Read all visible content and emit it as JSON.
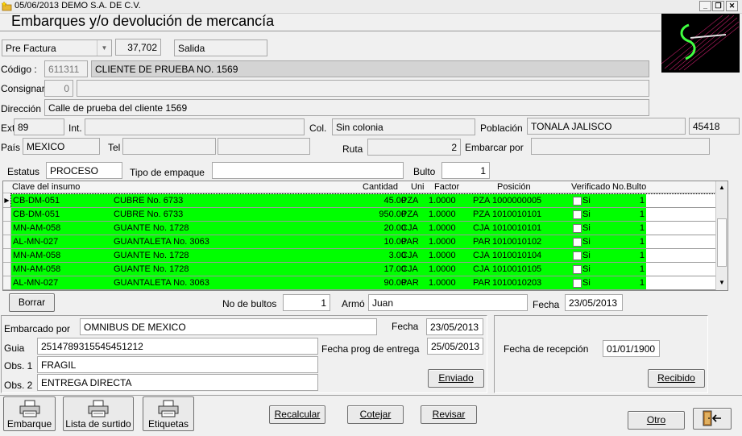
{
  "window": {
    "title": "05/06/2013  DEMO  S.A. DE C.V.",
    "heading": "Embarques y/o devolución de mercancía",
    "controls": [
      "_",
      "❐",
      "✕"
    ]
  },
  "doc": {
    "type_selected": "Pre Factura",
    "number": "37,702",
    "movement": "Salida"
  },
  "client": {
    "codigo_label": "Código :",
    "codigo": "611311",
    "name": "CLIENTE DE PRUEBA NO. 1569",
    "consignar_label": "Consignar",
    "consignar": "0",
    "consignar_name": "",
    "direccion_label": "Dirección :",
    "direccion": "Calle de prueba del cliente 1569",
    "ext_label": "Ext.",
    "ext": "89",
    "int_label": "Int.",
    "int": "",
    "col_label": "Col.",
    "col": "Sin colonia",
    "poblacion_label": "Población",
    "poblacion": "TONALA  JALISCO",
    "cp": "45418",
    "pais_label": "País :",
    "pais": "MEXICO",
    "tel_label": "Tel",
    "tel": "",
    "tel2": "",
    "ruta_label": "Ruta",
    "ruta": "2",
    "embarcar_label": "Embarcar por",
    "embarcar": ""
  },
  "status": {
    "estatus_label": "Estatus",
    "estatus": "PROCESO",
    "tipo_empaque_label": "Tipo de empaque",
    "tipo_empaque": "",
    "bulto_label": "Bulto",
    "bulto": "1"
  },
  "grid": {
    "headers": {
      "clave": "Clave del insumo",
      "cantidad": "Cantidad",
      "uni": "Uni",
      "factor": "Factor",
      "posicion": "Posición",
      "verificado": "Verificado",
      "nobulto": "No.Bulto"
    },
    "rows": [
      {
        "clave": "CB-DM-051",
        "desc": "CUBRE No. 6733",
        "cantidad": "45.00",
        "uni": "PZA",
        "factor": "1.0000",
        "uni2": "PZA",
        "posicion": "1000000005",
        "verificado": "Si",
        "bulto": "1"
      },
      {
        "clave": "CB-DM-051",
        "desc": "CUBRE No. 6733",
        "cantidad": "950.00",
        "uni": "PZA",
        "factor": "1.0000",
        "uni2": "PZA",
        "posicion": "1010010101",
        "verificado": "Si",
        "bulto": "1"
      },
      {
        "clave": "MN-AM-058",
        "desc": "GUANTE No. 1728",
        "cantidad": "20.00",
        "uni": "CJA",
        "factor": "1.0000",
        "uni2": "CJA",
        "posicion": "1010010101",
        "verificado": "Si",
        "bulto": "1"
      },
      {
        "clave": "AL-MN-027",
        "desc": "GUANTALETA No. 3063",
        "cantidad": "10.00",
        "uni": "PAR",
        "factor": "1.0000",
        "uni2": "PAR",
        "posicion": "1010010102",
        "verificado": "Si",
        "bulto": "1"
      },
      {
        "clave": "MN-AM-058",
        "desc": "GUANTE No. 1728",
        "cantidad": "3.00",
        "uni": "CJA",
        "factor": "1.0000",
        "uni2": "CJA",
        "posicion": "1010010104",
        "verificado": "Si",
        "bulto": "1"
      },
      {
        "clave": "MN-AM-058",
        "desc": "GUANTE No. 1728",
        "cantidad": "17.00",
        "uni": "CJA",
        "factor": "1.0000",
        "uni2": "CJA",
        "posicion": "1010010105",
        "verificado": "Si",
        "bulto": "1"
      },
      {
        "clave": "AL-MN-027",
        "desc": "GUANTALETA No. 3063",
        "cantidad": "90.00",
        "uni": "PAR",
        "factor": "1.0000",
        "uni2": "PAR",
        "posicion": "1010010203",
        "verificado": "Si",
        "bulto": "1"
      }
    ],
    "row_color": "#00ff00"
  },
  "middle": {
    "borrar": "Borrar",
    "no_bultos_label": "No de bultos",
    "no_bultos": "1",
    "armo_label": "Armó",
    "armo": "Juan",
    "fecha_label": "Fecha",
    "fecha": "23/05/2013"
  },
  "shipping": {
    "embarcado_label": "Embarcado por",
    "embarcado": "OMNIBUS DE MEXICO",
    "fecha_label": "Fecha",
    "fecha": "23/05/2013",
    "guia_label": "Guia",
    "guia": "2514789315545451212",
    "fecha_prog_label": "Fecha prog de entrega",
    "fecha_prog": "25/05/2013",
    "obs1_label": "Obs. 1",
    "obs1": "FRAGIL",
    "obs2_label": "Obs. 2",
    "obs2": "ENTREGA DIRECTA",
    "enviado": "Enviado"
  },
  "reception": {
    "fecha_label": "Fecha de recepción",
    "fecha": "01/01/1900",
    "recibido": "Recibido"
  },
  "bottom": {
    "embarque": "Embarque",
    "lista_surtido": "Lista de surtido",
    "etiquetas": "Etiquetas",
    "recalcular": "Recalcular",
    "cotejar": "Cotejar",
    "revisar": "Revisar",
    "otro": "Otro"
  },
  "icons": {
    "app": "folder-star-icon",
    "printer": "printer-icon",
    "exit": "exit-door-icon"
  }
}
